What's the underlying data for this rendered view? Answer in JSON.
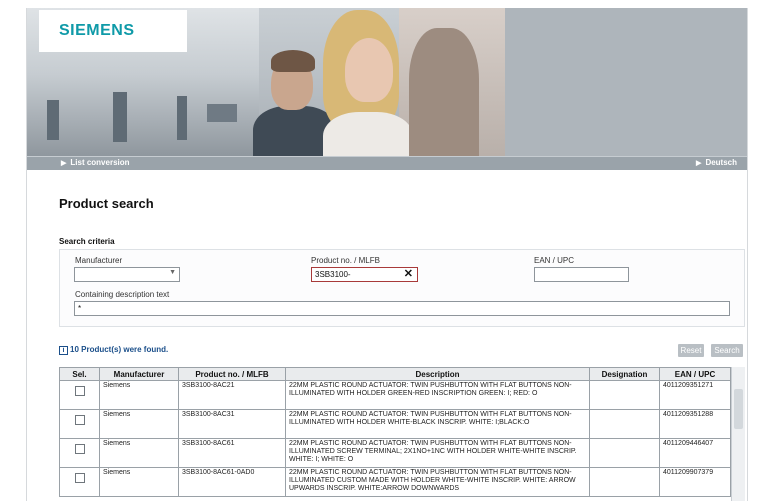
{
  "brand": {
    "logo": "SIEMENS",
    "logo_color": "#0f9aa8"
  },
  "nav": {
    "left": "List conversion",
    "right": "Deutsch"
  },
  "page": {
    "title": "Product search",
    "criteria_label": "Search criteria"
  },
  "search": {
    "manufacturer_label": "Manufacturer",
    "manufacturer_value": "",
    "product_label": "Product no. / MLFB",
    "product_value": "3SB3100-",
    "ean_label": "EAN / UPC",
    "ean_value": "",
    "description_label": "Containing description text",
    "description_value": "*"
  },
  "results": {
    "found_text": "10 Product(s) were found.",
    "reset_label": "Reset",
    "search_label": "Search"
  },
  "table": {
    "headers": [
      "Sel.",
      "Manufacturer",
      "Product no. / MLFB",
      "Description",
      "Designation",
      "EAN / UPC"
    ],
    "rows": [
      {
        "manufacturer": "Siemens",
        "product": "3SB3100-8AC21",
        "description": "22MM PLASTIC ROUND ACTUATOR: TWIN PUSHBUTTON WITH FLAT BUTTONS NON-ILLUMINATED WITH HOLDER GREEN-RED INSCRIPTION GREEN: I; RED: O",
        "designation": "",
        "ean": "4011209351271"
      },
      {
        "manufacturer": "Siemens",
        "product": "3SB3100-8AC31",
        "description": "22MM PLASTIC ROUND ACTUATOR: TWIN PUSHBUTTON WITH FLAT BUTTONS NON-ILLUMINATED WITH HOLDER WHITE-BLACK INSCRIP. WHITE: I;BLACK:O",
        "designation": "",
        "ean": "4011209351288"
      },
      {
        "manufacturer": "Siemens",
        "product": "3SB3100-8AC61",
        "description": "22MM PLASTIC ROUND ACTUATOR: TWIN PUSHBUTTON WITH FLAT BUTTONS NON-ILLUMINATED SCREW TERMINAL; 2X1NO+1NC WITH HOLDER WHITE-WHITE INSCRIP. WHITE: I; WHITE: O",
        "designation": "",
        "ean": "4011209446407"
      },
      {
        "manufacturer": "Siemens",
        "product": "3SB3100-8AC61-0AD0",
        "description": "22MM PLASTIC ROUND ACTUATOR: TWIN PUSHBUTTON WITH FLAT BUTTONS NON-ILLUMINATED CUSTOM MADE WITH HOLDER WHITE-WHITE INSCRIP. WHITE: ARROW UPWARDS INSCRIP. WHITE:ARROW DOWNWARDS",
        "designation": "",
        "ean": "4011209907379"
      }
    ]
  },
  "icons": {
    "info": "info-icon",
    "clear": "clear-icon",
    "checkbox": "checkbox-icon",
    "arrow": "arrow-right-icon"
  }
}
